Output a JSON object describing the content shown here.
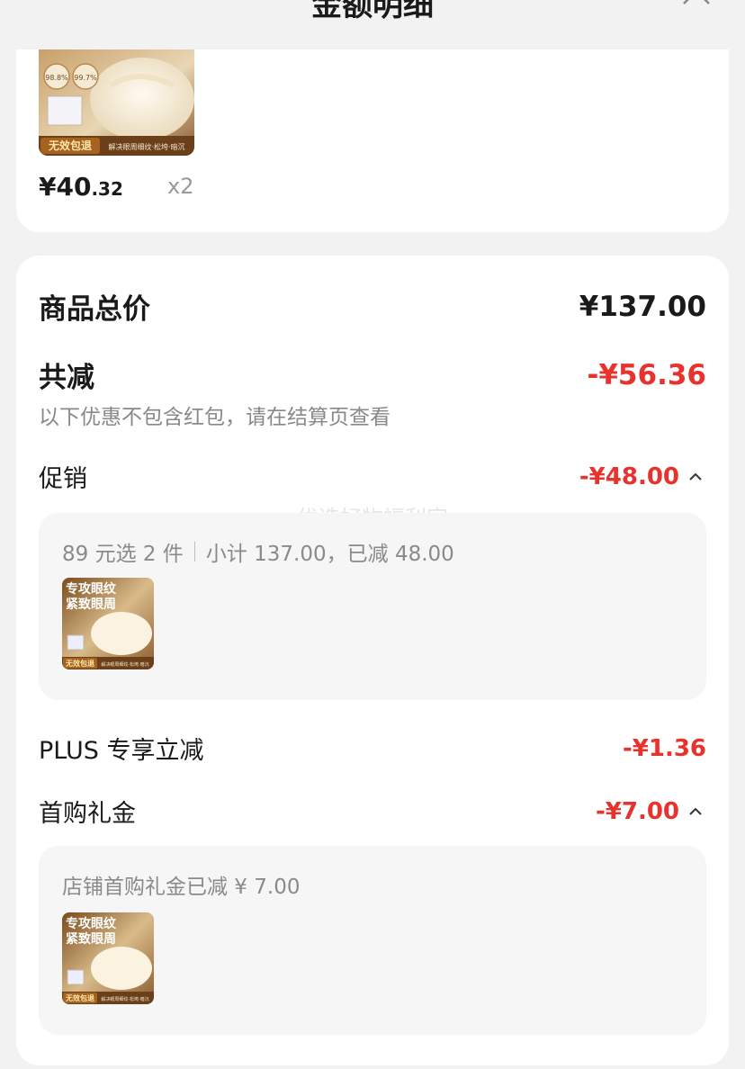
{
  "header": {
    "title": "金额明细",
    "close_icon": "close-icon"
  },
  "product": {
    "price_int": "¥40",
    "price_dec": ".32",
    "quantity": "x2",
    "image_badge": "无效包退",
    "image_tagline": "解决眼周细纹·松垮·暗沉",
    "image_stat_1": "98.8%",
    "image_stat_2": "99.7%"
  },
  "summary": {
    "total_label": "商品总价",
    "total_amount": "¥137.00",
    "discount_label": "共减",
    "discount_amount": "-¥56.36",
    "discount_note": "以下优惠不包含红包，请在结算页查看"
  },
  "promo": {
    "label": "促销",
    "amount": "-¥48.00",
    "detail_rule": "89 元选 2 件",
    "detail_summary": "小计 137.00，已减 48.00",
    "watermark": "优选好物福利官"
  },
  "plus": {
    "label": "PLUS 专享立减",
    "amount": "-¥1.36"
  },
  "first_buy": {
    "label": "首购礼金",
    "amount": "-¥7.00",
    "detail": "店铺首购礼金已减 ¥ 7.00"
  },
  "thumb": {
    "title_line_1": "专攻眼纹",
    "title_line_2": "紧致眼周",
    "badge": "无效包退",
    "tagline": "解决眼周细纹·松垮·暗沉"
  },
  "colors": {
    "accent_red": "#e8322d",
    "background": "#f2f2f2"
  }
}
